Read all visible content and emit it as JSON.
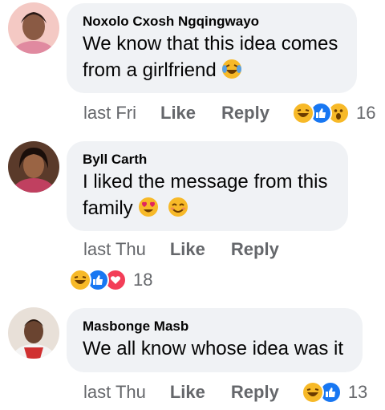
{
  "comments": [
    {
      "author": "Noxolo Cxosh Ngqingwayo",
      "text": "We know that this idea comes from a girlfriend",
      "inline_emojis": [
        "tears-of-joy-emoji"
      ],
      "time": "last Fri",
      "like_label": "Like",
      "reply_label": "Reply",
      "reactions": [
        "haha",
        "like",
        "wow"
      ],
      "reaction_count": "16"
    },
    {
      "author": "Byll Carth",
      "text": "I liked the message from this family",
      "inline_emojis": [
        "heart-eyes-emoji",
        "smiling-emoji"
      ],
      "time": "last Thu",
      "like_label": "Like",
      "reply_label": "Reply",
      "reactions": [
        "haha",
        "like",
        "love"
      ],
      "reaction_count": "18"
    },
    {
      "author": "Masbonge Masb",
      "text": "We all know whose idea was it",
      "inline_emojis": [],
      "time": "last Thu",
      "like_label": "Like",
      "reply_label": "Reply",
      "reactions": [
        "haha",
        "like"
      ],
      "reaction_count": "13"
    }
  ],
  "colors": {
    "bubble": "#f0f2f5",
    "meta_text": "#65676b",
    "like_blue": "#1877f2",
    "love_red": "#f33e58",
    "emoji_yellow": "#f7b928"
  }
}
